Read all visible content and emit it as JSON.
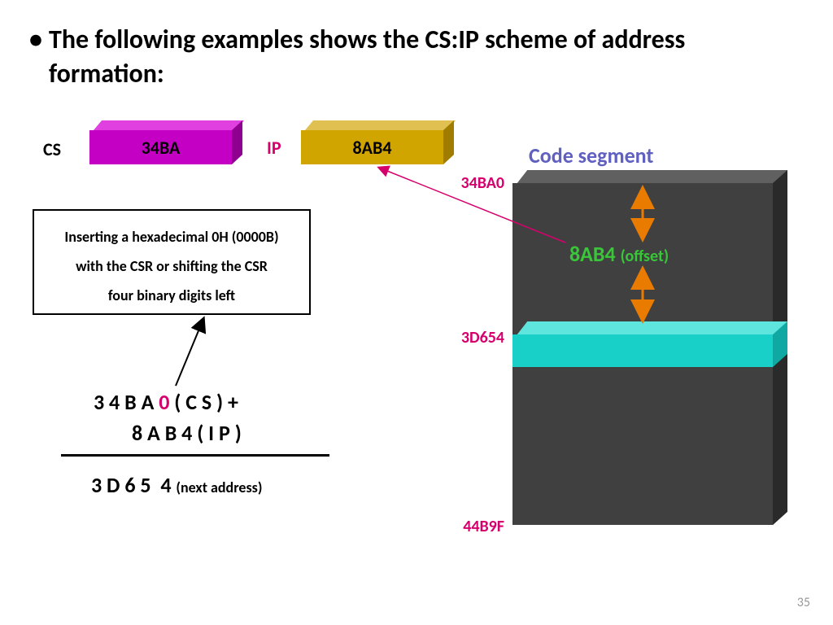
{
  "title": "The following examples shows the CS:IP scheme of address formation:",
  "labels": {
    "cs": "CS",
    "ip": "IP"
  },
  "blocks": {
    "cs_value": "34BA",
    "ip_value": "8AB4"
  },
  "note": {
    "line1": "Inserting a hexadecimal 0H (0000B)",
    "line2": "with the CSR or shifting the CSR",
    "line3": "four binary digits left"
  },
  "calc": {
    "prefix": "3 4 B A ",
    "zero": "0",
    "cs_part": " ( C S ) +",
    "ip_line": "8 A B 4 ( I P )",
    "result_hex": "3 D 6 5  4 ",
    "result_note": "(next address)"
  },
  "segment": {
    "title": "Code segment",
    "addr_start": "34BA0",
    "addr_mid": "3D654",
    "addr_end": "44B9F",
    "offset_value": "8AB4 ",
    "offset_label": "(offset)"
  },
  "page": "35"
}
